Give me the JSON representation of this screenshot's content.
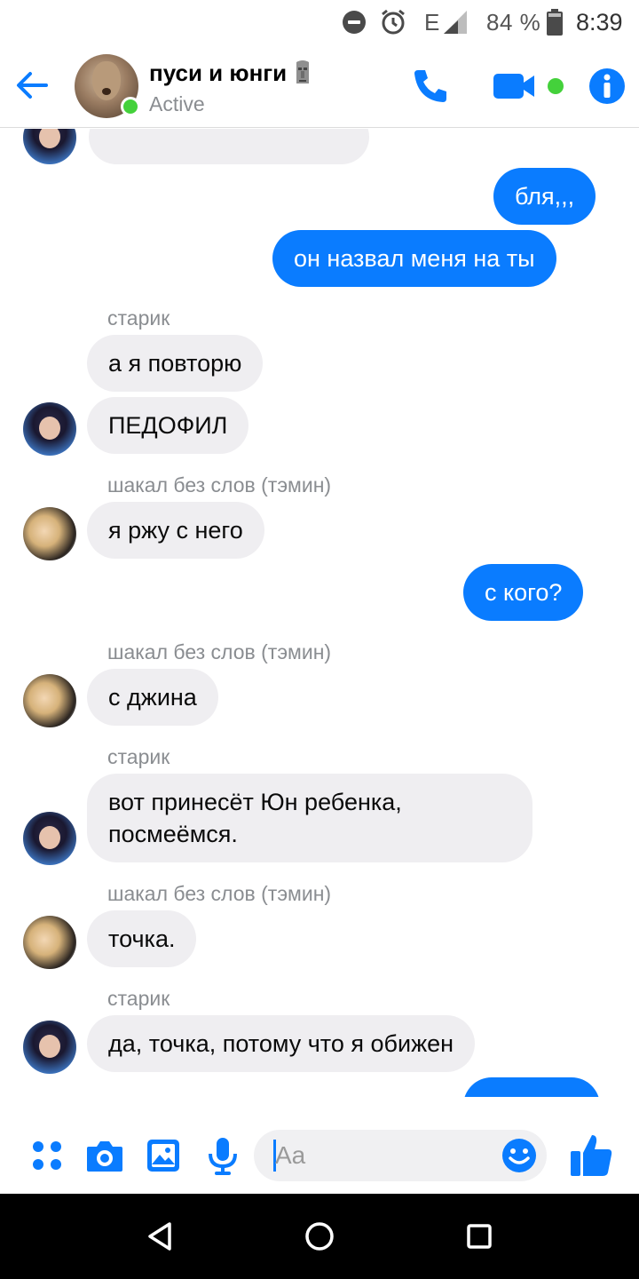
{
  "status_bar": {
    "network": "E",
    "battery": "84 %",
    "time": "8:39"
  },
  "header": {
    "title": "пуси и юнги",
    "status": "Active",
    "accent": "#0a7cff"
  },
  "messages": {
    "m1": "бля,,,",
    "m2": "он назвал меня на ты",
    "sender1": "старик",
    "m3": "а я повторю",
    "m4": "ПЕДОФИЛ",
    "sender2": "шакал без слов (тэмин)",
    "m5": "я ржу с него",
    "m6": "с кого?",
    "sender3": "шакал без слов (тэмин)",
    "m7": "с джина",
    "sender4": "старик",
    "m8": "вот принесёт Юн ребенка, посмеёмся.",
    "sender5": "шакал без слов (тэмин)",
    "m9": "точка.",
    "sender6": "старик",
    "m10": "да, точка, потому что я обижен"
  },
  "composer": {
    "placeholder": "Aa"
  },
  "colors": {
    "outgoing_bubble": "#0a7cff",
    "incoming_bubble": "#efeef1",
    "active_green": "#44d13b"
  }
}
